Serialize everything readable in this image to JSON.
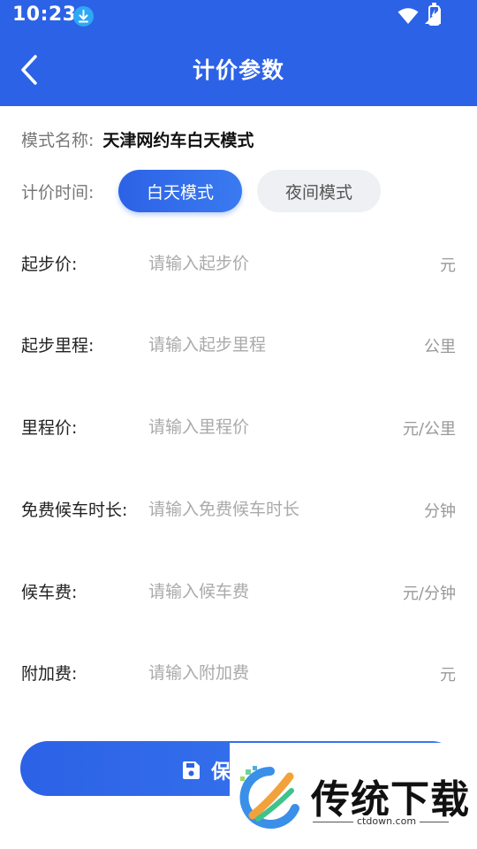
{
  "status_bar": {
    "time": "10:23"
  },
  "header": {
    "title": "计价参数"
  },
  "mode": {
    "label": "模式名称:",
    "value": "天津网约车白天模式"
  },
  "pricing_time": {
    "label": "计价时间:",
    "options": [
      "白天模式",
      "夜间模式"
    ],
    "selected": "白天模式"
  },
  "fields": [
    {
      "label": "起步价:",
      "placeholder": "请输入起步价",
      "unit": "元"
    },
    {
      "label": "起步里程:",
      "placeholder": "请输入起步里程",
      "unit": "公里"
    },
    {
      "label": "里程价:",
      "placeholder": "请输入里程价",
      "unit": "元/公里"
    },
    {
      "label": "免费候车时长:",
      "placeholder": "请输入免费候车时长",
      "unit": "分钟"
    },
    {
      "label": "候车费:",
      "placeholder": "请输入候车费",
      "unit": "元/分钟"
    },
    {
      "label": "附加费:",
      "placeholder": "请输入附加费",
      "unit": "元"
    }
  ],
  "save": {
    "label": "保"
  },
  "watermark": {
    "text": "传统下载",
    "url": "ctdown.com"
  },
  "colors": {
    "primary": "#2c62e6",
    "pill_inactive": "#eef0f3",
    "placeholder": "#aaaaaa"
  }
}
